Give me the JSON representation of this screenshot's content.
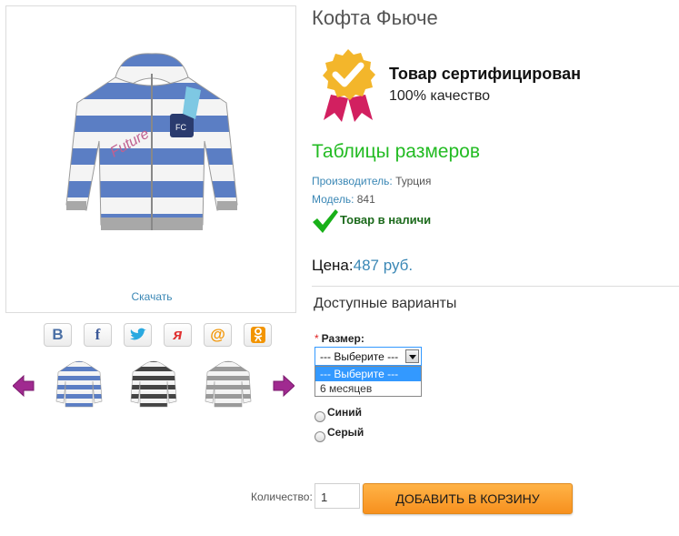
{
  "product": {
    "title": "Кофта Фьюче",
    "download_label": "Скачать"
  },
  "share": {
    "buttons": [
      {
        "name": "vk",
        "glyph": "B",
        "color": "#4a6fa5"
      },
      {
        "name": "facebook",
        "glyph": "f",
        "color": "#3b5998"
      },
      {
        "name": "twitter",
        "glyph": "🐦",
        "color": "#2aa9e0"
      },
      {
        "name": "yaru",
        "glyph": "я",
        "color": "#e03030"
      },
      {
        "name": "mail",
        "glyph": "@",
        "color": "#f29400"
      },
      {
        "name": "odnoklassniki",
        "glyph": "ok",
        "color": "#f29400"
      }
    ]
  },
  "certificate": {
    "title": "Товар сертифицирован",
    "subtitle": "100% качество"
  },
  "size_table_link": "Таблицы размеров",
  "info": {
    "manufacturer_label": "Производитель:",
    "manufacturer_value": "Турция",
    "model_label": "Модель:",
    "model_value": "841",
    "stock": "Товар в наличи"
  },
  "price": {
    "label": "Цена:",
    "value": "487 руб."
  },
  "variants": {
    "title": "Доступные варианты",
    "size_label": "Размер:",
    "required_mark": "*",
    "select_value": "--- Выберите ---",
    "options": [
      "--- Выберите ---",
      "6 месяцев"
    ],
    "colors": [
      "Синий",
      "Серый"
    ]
  },
  "cart": {
    "qty_label": "Количество:",
    "qty_value": "1",
    "button_label": "ДОБАВИТЬ В КОРЗИНУ"
  },
  "colors": {
    "link_blue": "#3a87b5",
    "green": "#22bb22",
    "orange": "#f7901e",
    "hoodie_blue": "#5b7ec4",
    "arrow_purple": "#a02a90"
  }
}
